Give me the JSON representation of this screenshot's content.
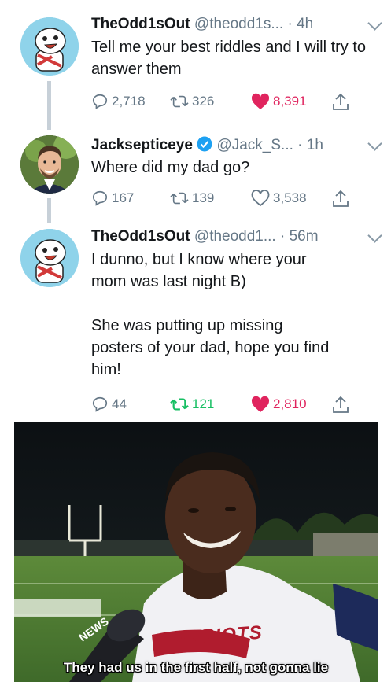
{
  "tweets": [
    {
      "name": "TheOdd1sOut",
      "handle": "@theodd1s...",
      "time": "· 4h",
      "text": "Tell me your best riddles and I will try to answer them",
      "replies": "2,718",
      "retweets": "326",
      "likes": "8,391",
      "liked": true,
      "retweeted": false
    },
    {
      "name": "Jacksepticeye",
      "handle": "@Jack_S...",
      "time": "· 1h",
      "verified": true,
      "text": "Where did my dad go?",
      "replies": "167",
      "retweets": "139",
      "likes": "3,538",
      "liked": false,
      "retweeted": false
    },
    {
      "name": "TheOdd1sOut",
      "handle": "@theodd1...",
      "time": "· 56m",
      "text_lines": [
        "I dunno, but I know where your",
        "mom was last night B)",
        "",
        "She was putting up missing",
        "posters of your dad, hope you find",
        "him!"
      ],
      "replies": "44",
      "retweets": "121",
      "likes": "2,810",
      "liked": true,
      "retweeted": true
    }
  ],
  "meme": {
    "caption": "They had us in the first half, not gonna lie",
    "mic_label": "NEWS",
    "jersey_text": "PATRIOTS"
  },
  "icons": {
    "reply": "reply-icon",
    "retweet": "retweet-icon",
    "like": "heart-icon",
    "share": "share-icon",
    "more": "chevron-down-icon",
    "verified": "verified-badge-icon"
  },
  "colors": {
    "liked": "#e0245e",
    "retweeted": "#17bf63",
    "muted": "#657786",
    "verified": "#1da1f2",
    "thread_line": "#c7d0d8"
  }
}
